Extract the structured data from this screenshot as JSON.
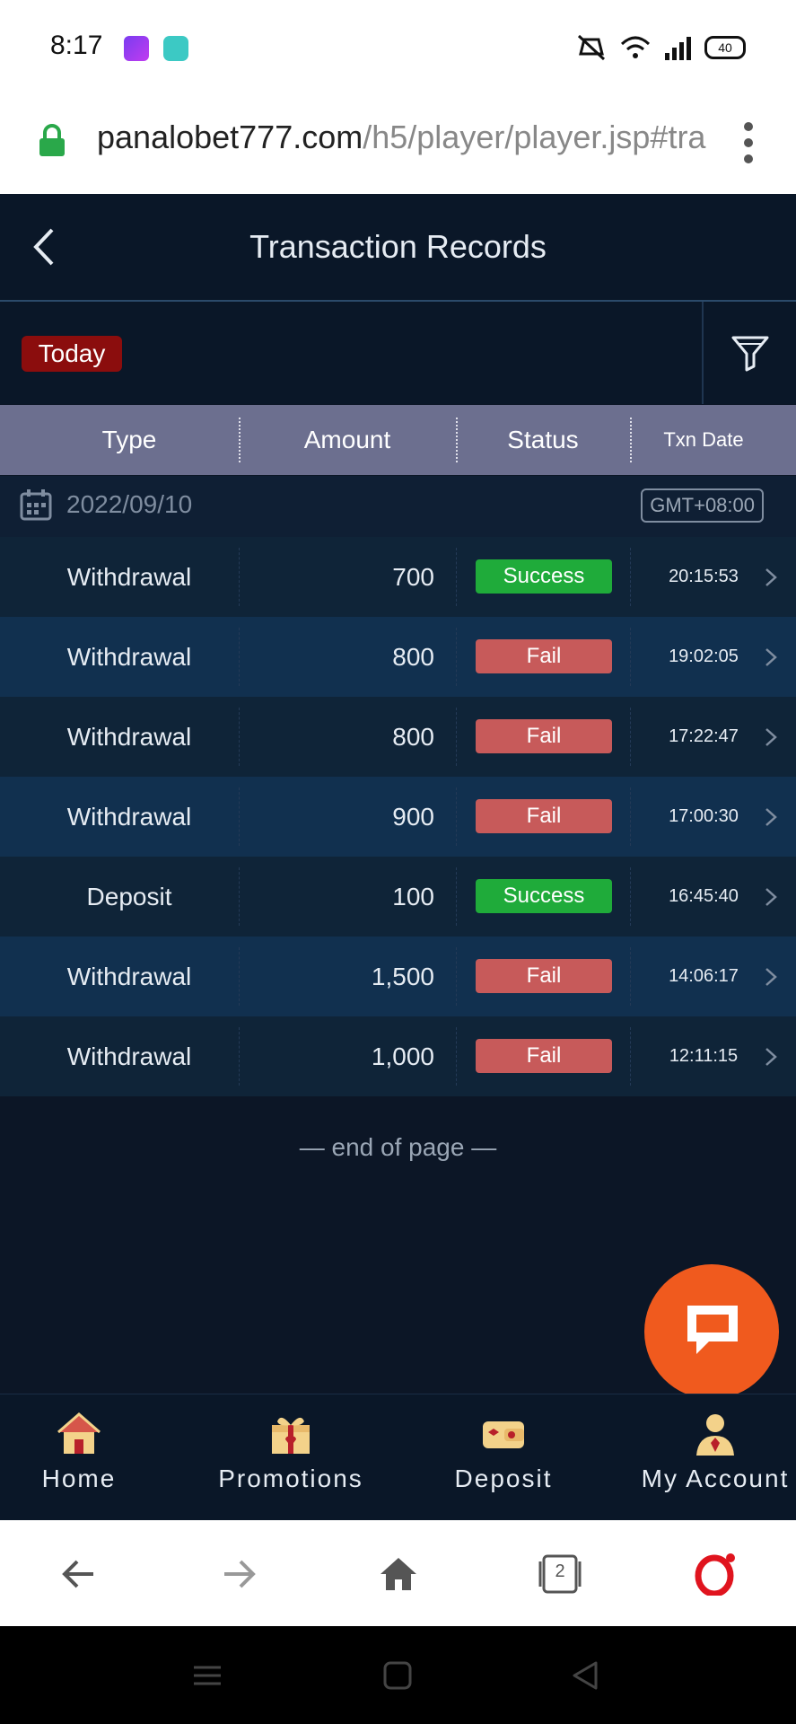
{
  "status_bar": {
    "time": "8:17",
    "battery": "40",
    "icons": [
      "app-icon",
      "chat-app-icon",
      "mute-icon",
      "wifi-icon",
      "signal-icon",
      "battery-icon"
    ]
  },
  "browser": {
    "url_domain": "panalobet777.com",
    "url_path": "/h5/player/player.jsp#tra",
    "tab_count": "2"
  },
  "header": {
    "title": "Transaction Records"
  },
  "filter": {
    "today_label": "Today"
  },
  "table": {
    "columns": [
      "Type",
      "Amount",
      "Status",
      "Txn Date"
    ],
    "date": "2022/09/10",
    "timezone": "GMT+08:00",
    "rows": [
      {
        "type": "Withdrawal",
        "amount": "700",
        "status": "Success",
        "time": "20:15:53"
      },
      {
        "type": "Withdrawal",
        "amount": "800",
        "status": "Fail",
        "time": "19:02:05"
      },
      {
        "type": "Withdrawal",
        "amount": "800",
        "status": "Fail",
        "time": "17:22:47"
      },
      {
        "type": "Withdrawal",
        "amount": "900",
        "status": "Fail",
        "time": "17:00:30"
      },
      {
        "type": "Deposit",
        "amount": "100",
        "status": "Success",
        "time": "16:45:40"
      },
      {
        "type": "Withdrawal",
        "amount": "1,500",
        "status": "Fail",
        "time": "14:06:17"
      },
      {
        "type": "Withdrawal",
        "amount": "1,000",
        "status": "Fail",
        "time": "12:11:15"
      }
    ],
    "end_text": "— end of page —"
  },
  "bottom_nav": {
    "items": [
      {
        "label": "Home",
        "icon": "home-icon"
      },
      {
        "label": "Promotions",
        "icon": "gift-icon"
      },
      {
        "label": "Deposit",
        "icon": "wallet-icon"
      },
      {
        "label": "My Account",
        "icon": "account-icon"
      }
    ]
  },
  "colors": {
    "success": "#1fab3a",
    "fail": "#c75a5a",
    "today_chip": "#8b0d0d",
    "chat_fab": "#f05a1e",
    "header_bg": "#6c6f8f"
  }
}
